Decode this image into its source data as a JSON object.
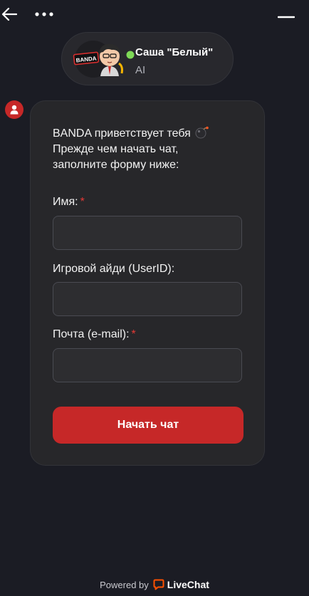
{
  "header": {
    "back_icon": "arrow-left-icon",
    "more_icon": "more-horizontal-icon",
    "minimize_icon": "minimize-icon"
  },
  "agent": {
    "name": "Саша \"Белый\"",
    "role": "AI",
    "avatar_badge_text": "BANDA",
    "online_color": "#7ed957"
  },
  "message": {
    "greeting_line1": "BANDA приветствует тебя",
    "greeting_line2": "Прежде чем начать чат,",
    "greeting_line3": "заполните форму ниже:",
    "emoji_icon": "bomb-icon"
  },
  "form": {
    "name_label": "Имя:",
    "name_required": "*",
    "name_value": "",
    "userid_label": "Игровой айди (UserID):",
    "userid_value": "",
    "email_label": "Почта (e-mail):",
    "email_required": "*",
    "email_value": "",
    "submit_label": "Начать чат"
  },
  "footer": {
    "powered_by": "Powered by",
    "brand": "LiveChat"
  },
  "colors": {
    "background": "#1b1c24",
    "card": "#27272a",
    "accent": "#c62828",
    "required": "#e53935",
    "livechat_orange": "#ff5100"
  }
}
